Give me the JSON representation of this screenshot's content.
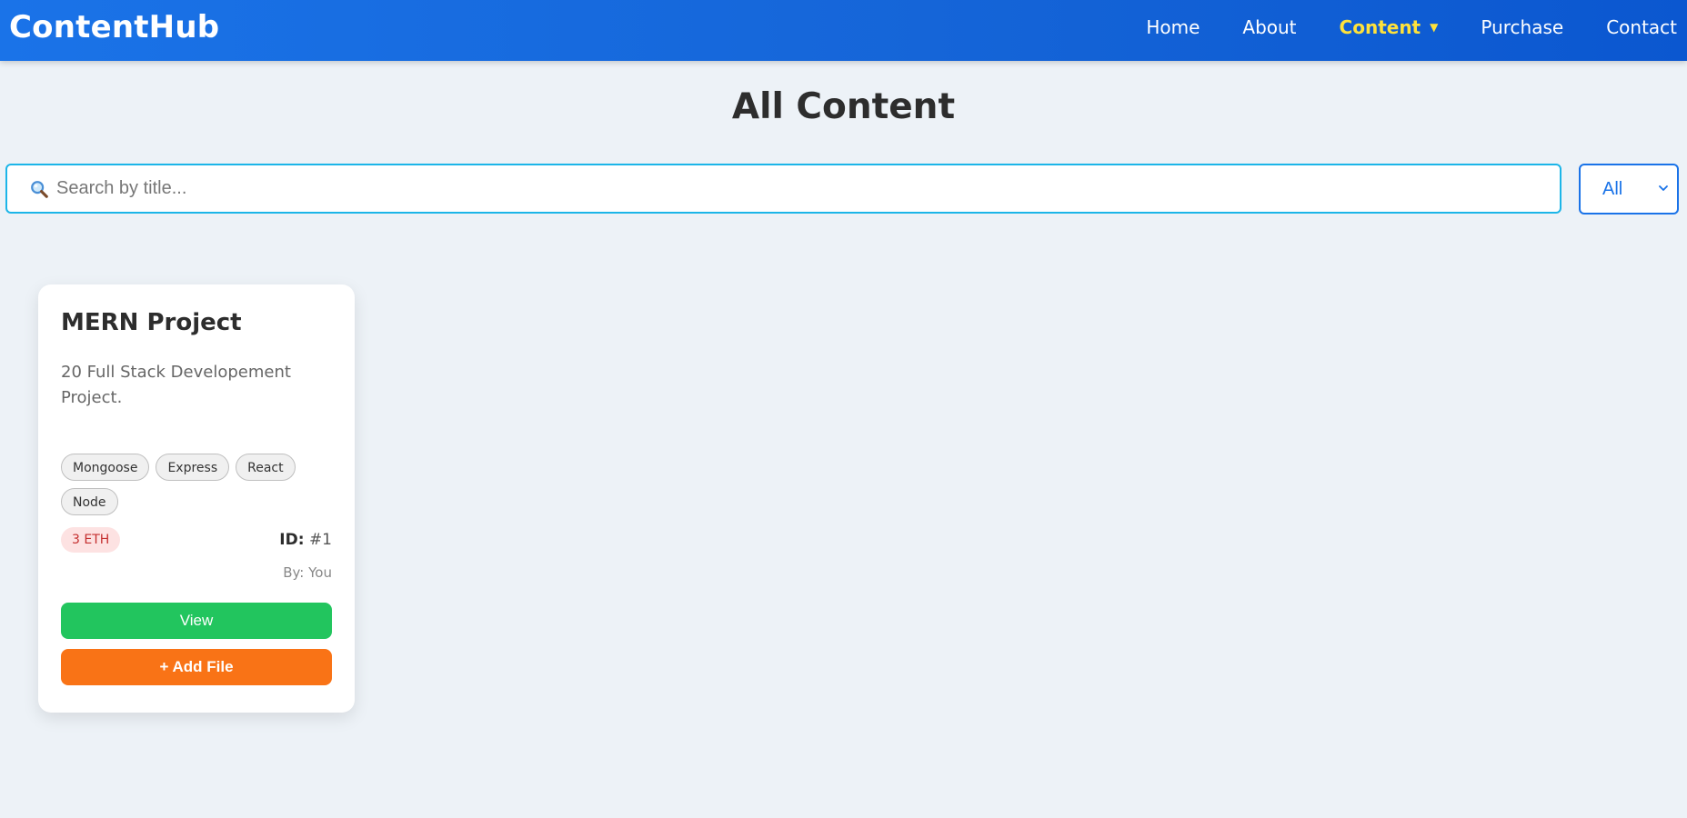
{
  "app": {
    "brand": "ContentHub"
  },
  "nav": {
    "items": [
      {
        "label": "Home"
      },
      {
        "label": "About"
      },
      {
        "label": "Content"
      },
      {
        "label": "Purchase"
      },
      {
        "label": "Contact"
      }
    ],
    "active_index": 2,
    "caret": "▼"
  },
  "page": {
    "title": "All Content"
  },
  "search": {
    "placeholder": "Search by title...",
    "value": ""
  },
  "filter": {
    "selected": "All"
  },
  "cards": [
    {
      "title": "MERN Project",
      "description": "20 Full Stack Developement Project.",
      "tags": [
        "Mongoose",
        "Express",
        "React",
        "Node"
      ],
      "price": "3 ETH",
      "id_label": "ID:",
      "id_value": "#1",
      "author": "By: You",
      "view_label": "View",
      "add_file_label": "+ Add File"
    }
  ],
  "colors": {
    "nav_gradient_start": "#1a73e8",
    "nav_gradient_end": "#0b57d0",
    "nav_active": "#ffe23b",
    "page_bg": "#edf2f7",
    "search_border": "#1cb5e8",
    "view_button": "#22c55e",
    "add_file_button": "#f97316",
    "price_badge_bg": "#fde2e2",
    "price_badge_text": "#c53030"
  },
  "icons": {
    "search": "search-icon",
    "select_chevron": "chevron-down-icon",
    "nav_caret": "caret-down-icon"
  }
}
